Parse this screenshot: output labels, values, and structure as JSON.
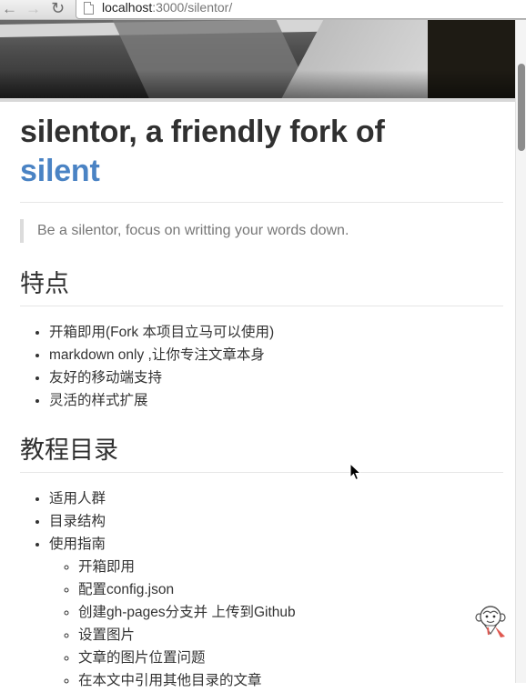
{
  "browser": {
    "url_host": "localhost",
    "url_path": ":3000/silentor/"
  },
  "page": {
    "title_prefix": "silentor, a friendly fork of",
    "title_link": "silent",
    "tagline": "Be a silentor, focus on writting your words down.",
    "features": {
      "heading": "特点",
      "items": [
        "开箱即用(Fork 本项目立马可以使用)",
        "markdown only ,让你专注文章本身",
        "友好的移动端支持",
        "灵活的样式扩展"
      ]
    },
    "toc": {
      "heading": "教程目录",
      "items": [
        "适用人群",
        "目录结构",
        "使用指南"
      ],
      "guide_subitems": [
        "开箱即用",
        "配置config.json",
        "创建gh-pages分支并 上传到Github",
        "设置图片",
        "文章的图片位置问题",
        "在本文中引用其他目录的文章"
      ]
    }
  },
  "icons": {
    "back": "back-arrow-icon",
    "forward": "forward-arrow-icon",
    "reload": "reload-icon",
    "page": "page-icon",
    "cursor": "mouse-cursor-icon",
    "mascot": "monkey-mascot-icon"
  },
  "colors": {
    "link": "#4a83c4",
    "text": "#333333",
    "muted": "#777777"
  }
}
